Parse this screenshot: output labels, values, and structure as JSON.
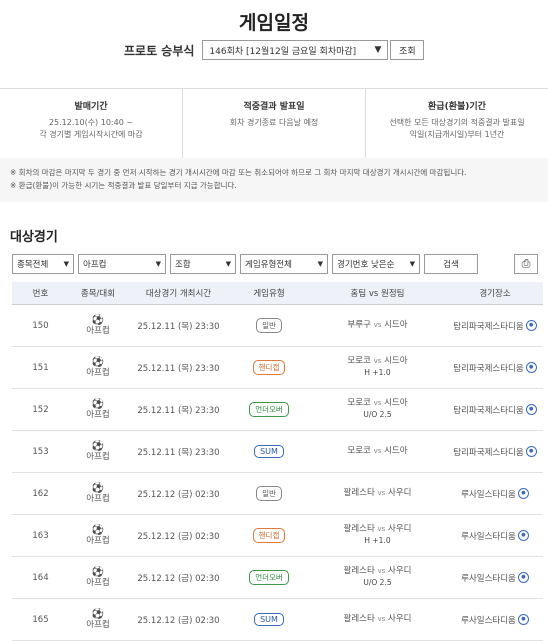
{
  "page_title": "게임일정",
  "game_label": "프로토 승부식",
  "round_select": "146회차 [12월12일 금요일 회차마감]",
  "lookup_button": "조회",
  "info": [
    {
      "title": "발매기간",
      "lines": [
        "25.12.10(수) 10:40 ~",
        "각 경기별 게임시작시간에 마감"
      ]
    },
    {
      "title": "적중결과 발표일",
      "lines": [
        "회차 경기종료 다음날 예정"
      ]
    },
    {
      "title": "환급(환불)기간",
      "lines": [
        "선택한 모든 대상경기의 적중결과 발표일",
        "익일(지급개시일)부터 1년간"
      ]
    }
  ],
  "notes": [
    "※ 회차의 마감은 마지막 두 경기 중 먼저 시작하는 경기 개시시간에 마감 또는 취소되어야 하므로 그 회차 마지막 대상경기 개시시간에 마감됩니다.",
    "※ 환급(환불)이 가능한 시기는 적중결과 발표 당일부터 지급 가능합니다."
  ],
  "section_title": "대상경기",
  "filters": {
    "sport": "종목전체",
    "league": "아프컵",
    "condition": "조합",
    "game_type": "게임유형전체",
    "sort": "경기번호 낮은순",
    "search_button": "검색"
  },
  "columns": [
    "번호",
    "종목/대회",
    "대상경기 개최시간",
    "게임유형",
    "홈팀 vs 원정팀",
    "경기장소"
  ],
  "vs_label": "vs",
  "rows": [
    {
      "no": "150",
      "league": "아프컵",
      "time": "25.12.11 (목) 23:30",
      "type": "일반",
      "home": "부루구",
      "away": "시드아",
      "sub": "",
      "venue": "탐리파국제스타디움"
    },
    {
      "no": "151",
      "league": "아프컵",
      "time": "25.12.11 (목) 23:30",
      "type": "핸디캡",
      "home": "모로코",
      "away": "시드아",
      "sub": "H +1.0",
      "venue": "탐리파국제스타디움"
    },
    {
      "no": "152",
      "league": "아프컵",
      "time": "25.12.11 (목) 23:30",
      "type": "언더오버",
      "home": "모로코",
      "away": "시드아",
      "sub": "U/O 2.5",
      "venue": "탐리파국제스타디움"
    },
    {
      "no": "153",
      "league": "아프컵",
      "time": "25.12.11 (목) 23:30",
      "type": "SUM",
      "home": "모로코",
      "away": "시드아",
      "sub": "",
      "venue": "탐리파국제스타디움"
    },
    {
      "no": "162",
      "league": "아프컵",
      "time": "25.12.12 (금) 02:30",
      "type": "일반",
      "home": "팔레스타",
      "away": "사우디",
      "sub": "",
      "venue": "루사일스타디움"
    },
    {
      "no": "163",
      "league": "아프컵",
      "time": "25.12.12 (금) 02:30",
      "type": "핸디캡",
      "home": "팔레스타",
      "away": "사우디",
      "sub": "H +1.0",
      "venue": "루사일스타디움"
    },
    {
      "no": "164",
      "league": "아프컵",
      "time": "25.12.12 (금) 02:30",
      "type": "언더오버",
      "home": "팔레스타",
      "away": "사우디",
      "sub": "U/O 2.5",
      "venue": "루사일스타디움"
    },
    {
      "no": "165",
      "league": "아프컵",
      "time": "25.12.12 (금) 02:30",
      "type": "SUM",
      "home": "팔레스타",
      "away": "사우디",
      "sub": "",
      "venue": "루사일스타디움"
    }
  ]
}
